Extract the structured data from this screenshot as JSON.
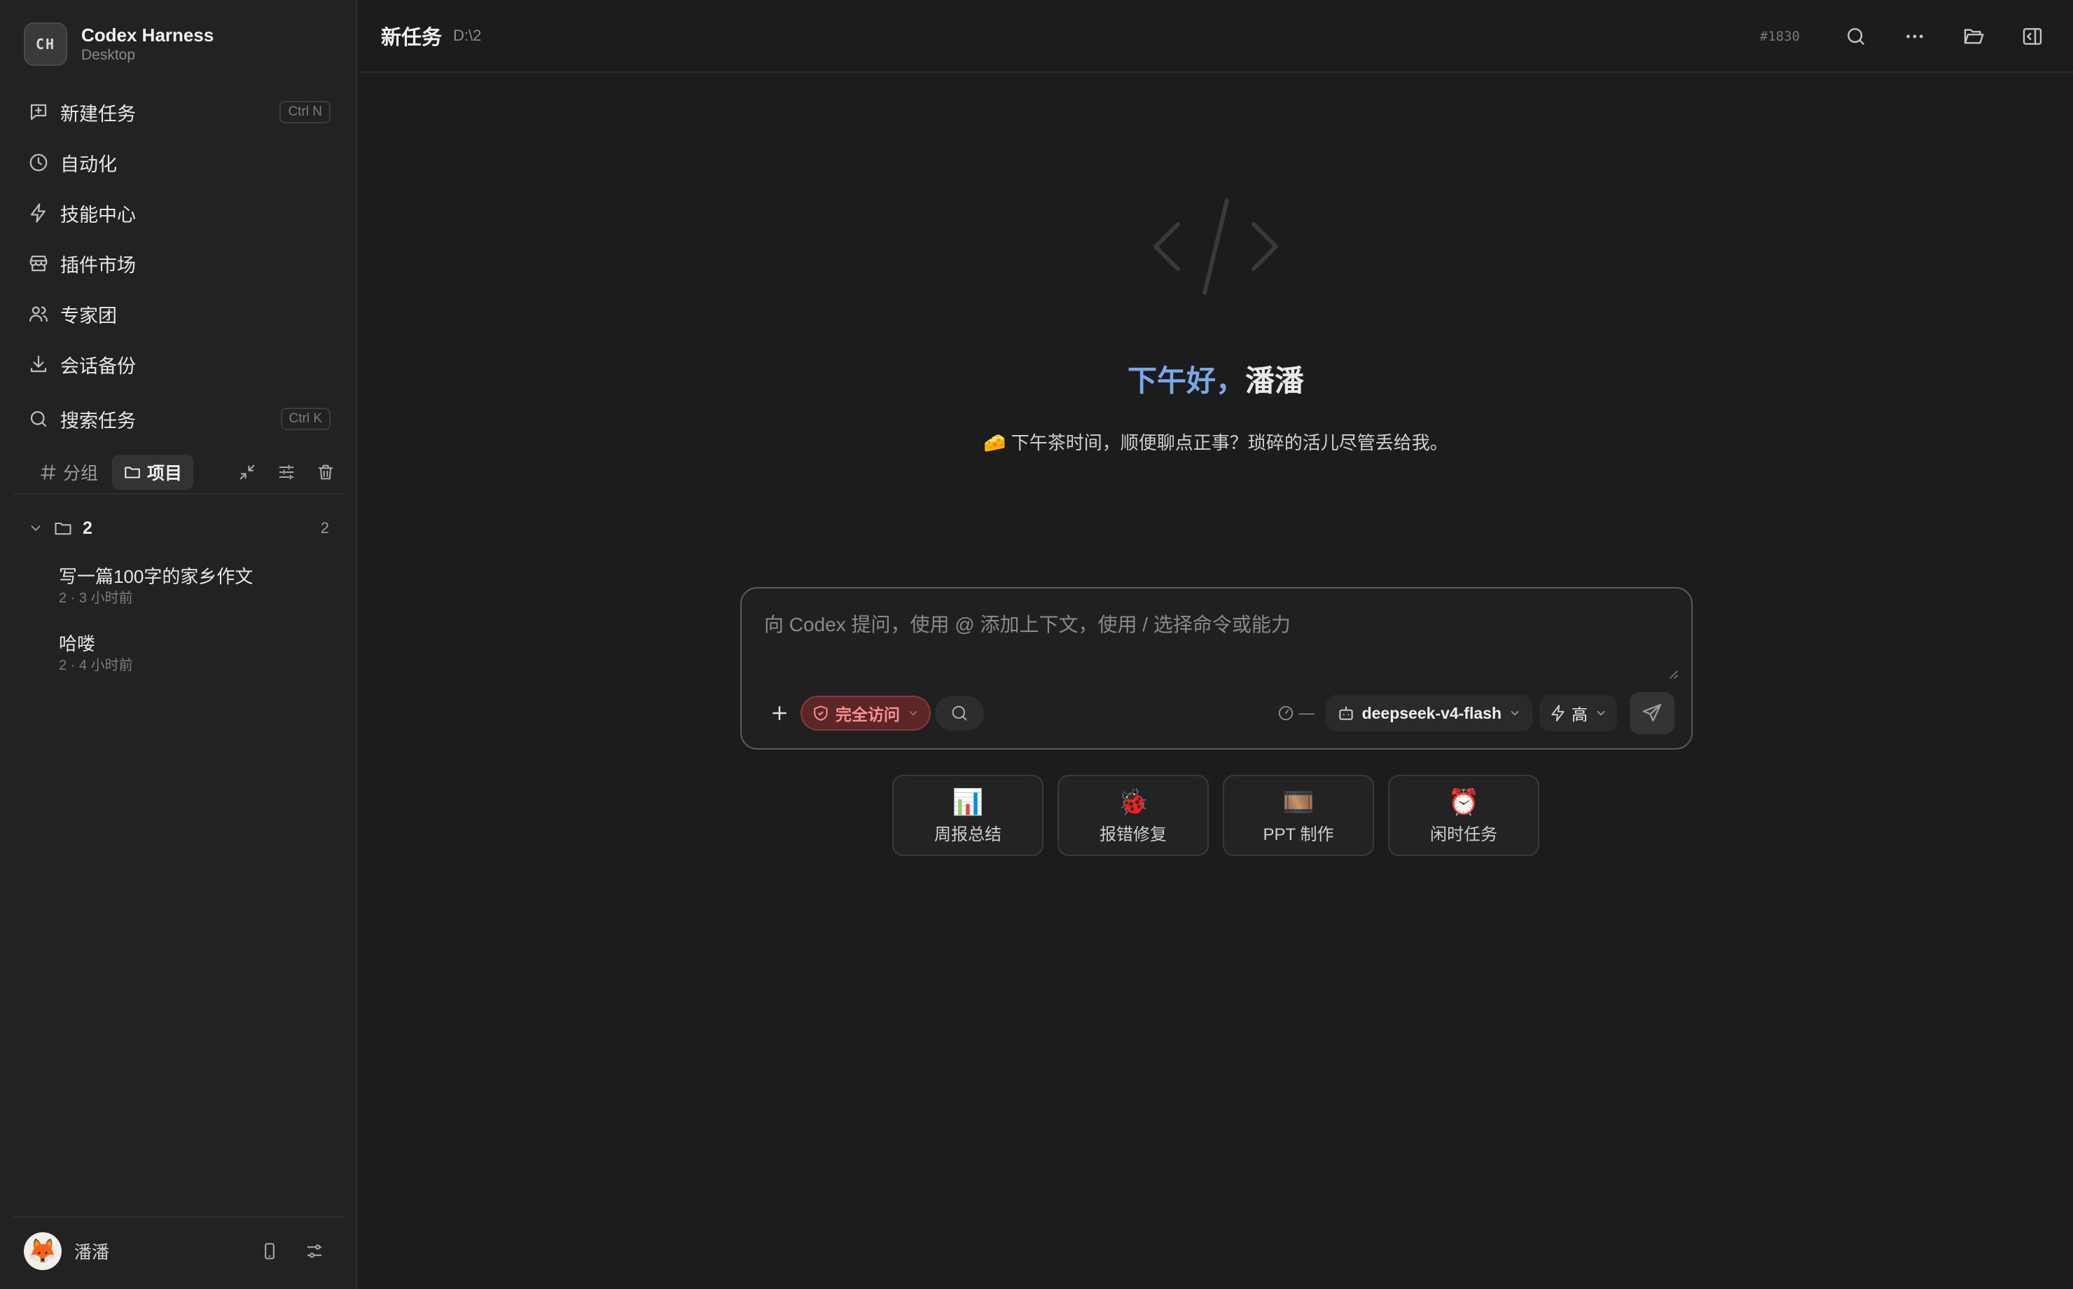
{
  "sidebar": {
    "brand": {
      "logo": "CH",
      "name": "Codex Harness",
      "subtitle": "Desktop"
    },
    "nav": [
      {
        "label": "新建任务",
        "icon": "new-task-icon",
        "shortcut": "Ctrl N"
      },
      {
        "label": "自动化",
        "icon": "clock-icon"
      },
      {
        "label": "技能中心",
        "icon": "lightning-icon"
      },
      {
        "label": "插件市场",
        "icon": "store-icon"
      },
      {
        "label": "专家团",
        "icon": "users-icon"
      },
      {
        "label": "会话备份",
        "icon": "download-icon"
      }
    ],
    "search": {
      "label": "搜索任务",
      "shortcut": "Ctrl K"
    },
    "tabs": [
      {
        "label": "分组",
        "icon": "hash-icon"
      },
      {
        "label": "项目",
        "icon": "folder-icon",
        "active": true
      }
    ],
    "group": {
      "name": "2",
      "count": "2"
    },
    "tasks": [
      {
        "title": "写一篇100字的家乡作文",
        "meta": "2 · 3 小时前"
      },
      {
        "title": "哈喽",
        "meta": "2 · 4 小时前"
      }
    ],
    "user": {
      "name": "潘潘",
      "avatar": "🦊"
    }
  },
  "topbar": {
    "title": "新任务",
    "path": "D:\\2",
    "id": "#1830"
  },
  "hero": {
    "greeting_accent": "下午好，",
    "greeting_name": "潘潘",
    "subline": "🧀 下午茶时间，顺便聊点正事？琐碎的活儿尽管丢给我。"
  },
  "composer": {
    "placeholder": "向 Codex 提问，使用 @ 添加上下文，使用 / 选择命令或能力",
    "value": "",
    "access_label": "完全访问",
    "context_indicator": "—",
    "model": "deepseek-v4-flash",
    "level": "高"
  },
  "quick_actions": [
    {
      "icon": "📊",
      "label": "周报总结"
    },
    {
      "icon": "🐞",
      "label": "报错修复"
    },
    {
      "icon": "🎞️",
      "label": "PPT 制作"
    },
    {
      "icon": "⏰",
      "label": "闲时任务"
    }
  ],
  "colors": {
    "background": "#1c1c1c",
    "sidebar": "#222222",
    "accent": "#7aa7e8",
    "danger": "#ff8e8e"
  }
}
